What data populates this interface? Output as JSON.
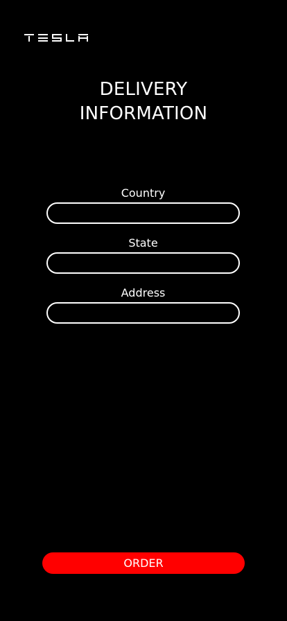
{
  "brand": {
    "logo_text": "TESLA",
    "logo_icon": "tesla-wordmark-logo"
  },
  "header": {
    "title": "DELIVERY\nINFORMATION"
  },
  "form": {
    "fields": [
      {
        "label": "Country",
        "value": "",
        "placeholder": ""
      },
      {
        "label": "State",
        "value": "",
        "placeholder": ""
      },
      {
        "label": "Address",
        "value": "",
        "placeholder": ""
      }
    ]
  },
  "actions": {
    "order_label": "ORDER"
  },
  "colors": {
    "background": "#000000",
    "text": "#ffffff",
    "accent": "#ff0000",
    "input_border": "#ffffff"
  }
}
